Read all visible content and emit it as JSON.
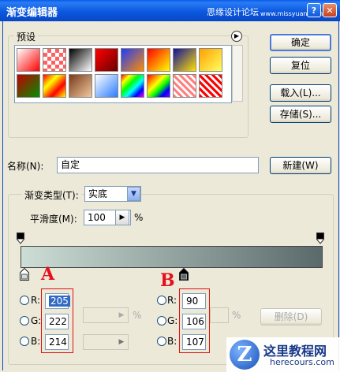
{
  "window": {
    "title": "渐变编辑器",
    "watermark_title": "思缘设计论坛",
    "watermark_title_small": "www.missyuan.com"
  },
  "buttons": {
    "ok": "确定",
    "reset": "复位",
    "load": "载入(L)...",
    "save": "存储(S)...",
    "new": "新建(W)",
    "delete": "删除(D)"
  },
  "presets": {
    "label": "预设",
    "swatches": [
      "linear-gradient(135deg,#ffffff 0%,#ff0000 100%)",
      "repeating-conic-gradient(#ff6060 0% 25%,#ffffff 0% 50%)",
      "linear-gradient(135deg,#000000,#ffffff)",
      "linear-gradient(135deg,#ff0000,#6b0000)",
      "linear-gradient(135deg,#1e3cff,#ff8c00)",
      "linear-gradient(135deg,#ff0000,#ffff00)",
      "linear-gradient(135deg,#1010a0,#ffe000)",
      "linear-gradient(135deg,#ffa000,#ffff60)",
      "linear-gradient(135deg,#c00000,#009000)",
      "linear-gradient(135deg,#ff0000,#ffff00,#ff0000,#ffff00)",
      "linear-gradient(135deg,#7a3a1a,#f0c8a0)",
      "linear-gradient(135deg,#ffffff,#2a7dff)",
      "linear-gradient(135deg,#ff0000,#ffff00,#00ff00,#00ffff,#0000ff,#ff00ff)",
      "linear-gradient(135deg,#ff0000,#ff8000,#ffff00,#00ff00,#0000ff,#8000ff)",
      "repeating-linear-gradient(45deg,#ff8080 0 3px,#ffffff 3px 6px)",
      "repeating-linear-gradient(45deg,#ff0000 0 3px,#ffffff 3px 6px)"
    ]
  },
  "name_row": {
    "label": "名称(N):",
    "value": "自定"
  },
  "gradient": {
    "type_label": "渐变类型(T):",
    "type_value": "实底",
    "smoothness_label": "平滑度(M):",
    "smoothness_value": "100",
    "percent": "%",
    "start_color": "#cddfd6",
    "end_color": "#5a6a6b"
  },
  "stop_a": {
    "marker": "A",
    "r_label": "R:",
    "g_label": "G:",
    "b_label": "B:",
    "r": "205",
    "g": "222",
    "b": "214"
  },
  "stop_b": {
    "marker": "B",
    "r_label": "R:",
    "g_label": "G:",
    "b_label": "B:",
    "r": "90",
    "g": "106",
    "b": "107"
  },
  "disabled_percent_1": "%",
  "disabled_percent_2": "%",
  "watermark": {
    "site_name": "这里教程网",
    "site_url": "herecours.com"
  }
}
